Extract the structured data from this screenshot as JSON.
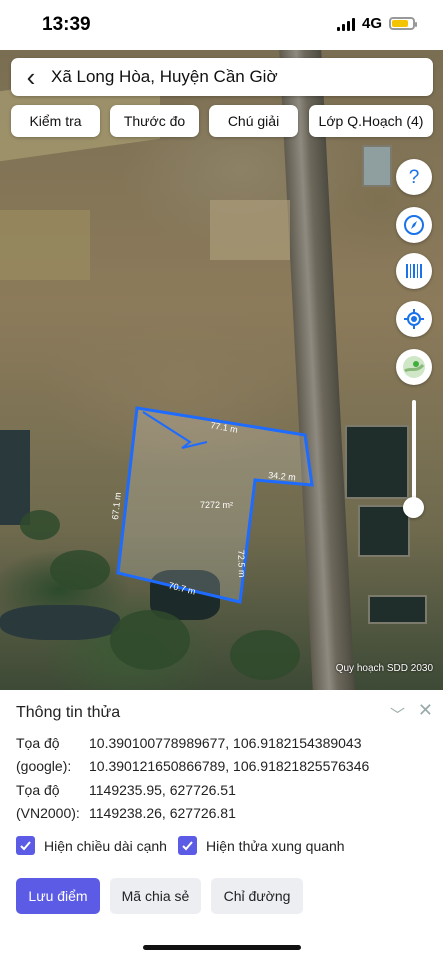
{
  "status": {
    "time": "13:39",
    "network": "4G"
  },
  "search": {
    "title": "Xã Long Hòa, Huyện Cần Giờ"
  },
  "tabs": [
    "Kiểm tra",
    "Thước đo",
    "Chú giải",
    "Lớp Q.Hoạch (4)"
  ],
  "map": {
    "edges": [
      "77.1 m",
      "34.2 m",
      "72.5 m",
      "70.7 m",
      "67.1 m"
    ],
    "area": "7272 m²",
    "watermark": "Quy hoạch SDD 2030",
    "zoom_level": 0.1,
    "boundary_color": "#1e6bff"
  },
  "panel": {
    "title": "Thông tin thửa",
    "rows": [
      {
        "label": "Tọa độ",
        "value": "10.390100778989677, 106.9182154389043"
      },
      {
        "label": "(google):",
        "value": "10.390121650866789, 106.91821825576346"
      },
      {
        "label": "Tọa độ",
        "value": "1149235.95, 627726.51"
      },
      {
        "label": "(VN2000):",
        "value": "1149238.26, 627726.81"
      }
    ],
    "checks": [
      "Hiện chiều dài cạnh",
      "Hiện thửa xung quanh"
    ],
    "buttons": [
      "Lưu điểm",
      "Mã chia sẻ",
      "Chỉ đường"
    ]
  },
  "colors": {
    "accent": "#5b5be6",
    "tool_icon": "#1a73e8"
  }
}
